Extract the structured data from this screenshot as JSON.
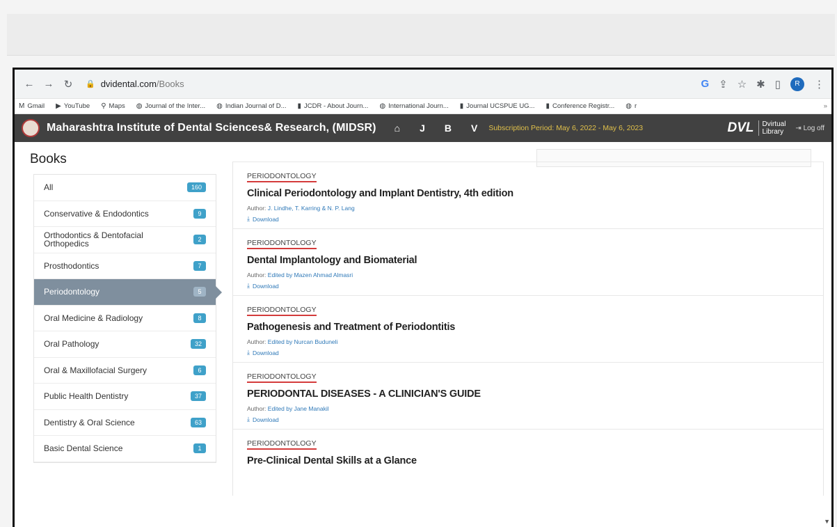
{
  "browser": {
    "url_host": "dvidental.com",
    "url_path": "/Books",
    "profile_initial": "R",
    "bookmarks": [
      {
        "icon": "gmail-icon",
        "label": "Gmail"
      },
      {
        "icon": "youtube-icon",
        "label": "YouTube"
      },
      {
        "icon": "maps-icon",
        "label": "Maps"
      },
      {
        "icon": "globe-icon",
        "label": "Journal of the Inter..."
      },
      {
        "icon": "globe-icon",
        "label": "Indian Journal of D..."
      },
      {
        "icon": "bookmark-icon",
        "label": "JCDR - About Journ..."
      },
      {
        "icon": "globe-icon",
        "label": "International Journ..."
      },
      {
        "icon": "bookmark-icon",
        "label": "Journal UCSPUE UG..."
      },
      {
        "icon": "bookmark-icon",
        "label": "Conference Registr..."
      },
      {
        "icon": "globe-icon",
        "label": "r"
      }
    ]
  },
  "site": {
    "title": "Maharashtra Institute of Dental Sciences& Research, (MIDSR)",
    "nav_letters": [
      "J",
      "B",
      "V"
    ],
    "subscription": "Subscription Period: May 6, 2022 - May 6, 2023",
    "logo": "DVL",
    "logo_line1": "Dvirtual",
    "logo_line2": "Library",
    "logoff": "Log off"
  },
  "page": {
    "heading": "Books"
  },
  "categories": [
    {
      "label": "All",
      "count": "160",
      "active": false
    },
    {
      "label": "Conservative & Endodontics",
      "count": "9",
      "active": false
    },
    {
      "label": "Orthodontics & Dentofacial Orthopedics",
      "count": "2",
      "active": false
    },
    {
      "label": "Prosthodontics",
      "count": "7",
      "active": false
    },
    {
      "label": "Periodontology",
      "count": "5",
      "active": true
    },
    {
      "label": "Oral Medicine & Radiology",
      "count": "8",
      "active": false
    },
    {
      "label": "Oral Pathology",
      "count": "32",
      "active": false
    },
    {
      "label": "Oral & Maxillofacial Surgery",
      "count": "6",
      "active": false
    },
    {
      "label": "Public Health Dentistry",
      "count": "37",
      "active": false
    },
    {
      "label": "Dentistry & Oral Science",
      "count": "63",
      "active": false
    },
    {
      "label": "Basic Dental Science",
      "count": "1",
      "active": false
    }
  ],
  "books": [
    {
      "category": "PERIODONTOLOGY",
      "title": "Clinical Periodontology and Implant Dentistry, 4th edition",
      "author_label": "Author:",
      "author": "J. Lindhe, T. Karring & N. P. Lang",
      "download": "Download"
    },
    {
      "category": "PERIODONTOLOGY",
      "title": "Dental Implantology and Biomaterial",
      "author_label": "Author:",
      "author": "Edited by Mazen Ahmad Almasri",
      "download": "Download"
    },
    {
      "category": "PERIODONTOLOGY",
      "title": "Pathogenesis and Treatment of Periodontitis",
      "author_label": "Author:",
      "author": "Edited by Nurcan Buduneli",
      "download": "Download"
    },
    {
      "category": "PERIODONTOLOGY",
      "title": "PERIODONTAL DISEASES - A CLINICIAN'S GUIDE",
      "author_label": "Author:",
      "author": "Edited by Jane Manakil",
      "download": "Download"
    },
    {
      "category": "PERIODONTOLOGY",
      "title": "Pre-Clinical Dental Skills at a Glance",
      "author_label": "",
      "author": "",
      "download": ""
    }
  ],
  "colors": {
    "site_bar": "#414141",
    "badge": "#3fa1c9",
    "active_category": "#7f8f9e",
    "category_underline": "#d43b3b",
    "subscription_text": "#e0c04a"
  }
}
